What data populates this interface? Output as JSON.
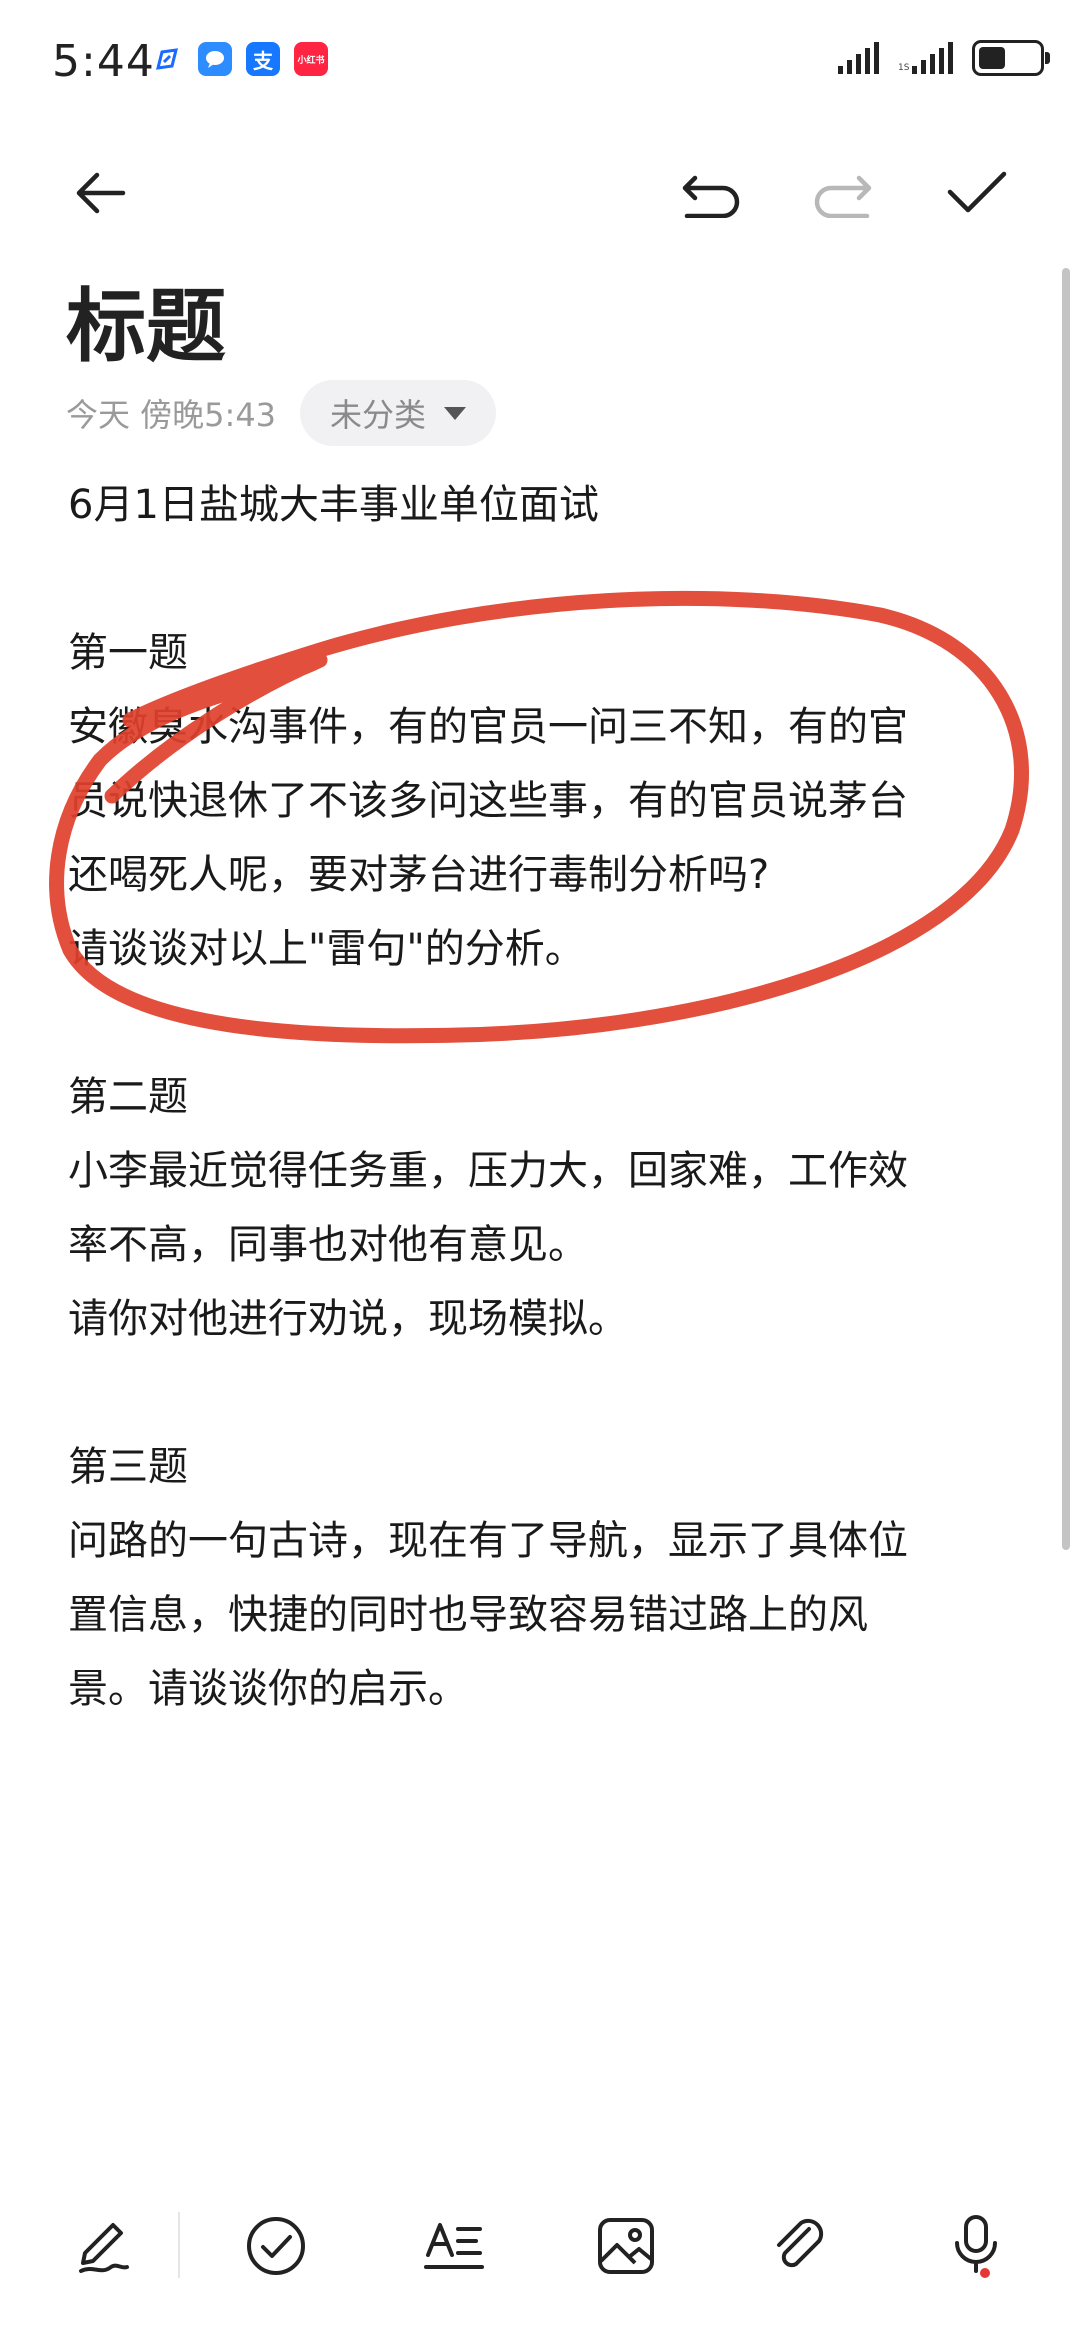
{
  "status_bar": {
    "time": "5:44",
    "notification_icons": [
      "edit-app-icon",
      "message-app-icon",
      "alipay-icon",
      "xiaohongshu-icon"
    ],
    "alipay_glyph": "支",
    "xiaohongshu_glyph": "小红书",
    "battery_level": 0.45
  },
  "toolbar": {
    "icons": [
      "back-arrow-icon",
      "undo-icon",
      "redo-icon",
      "checkmark-icon"
    ],
    "redo_disabled": true
  },
  "note": {
    "title": "标题",
    "date": "今天 傍晚5:43",
    "category": "未分类",
    "body_lines": [
      "6月1日盐城大丰事业单位面试",
      "",
      "第一题",
      "安徽臭水沟事件，有的官员一问三不知，有的官",
      "员说快退休了不该多问这些事，有的官员说茅台",
      "还喝死人呢，要对茅台进行毒制分析吗?",
      "请谈谈对以上\"雷句\"的分析。",
      "",
      "第二题",
      "小李最近觉得任务重，压力大，回家难，工作效",
      "率不高，同事也对他有意见。",
      "请你对他进行劝说，现场模拟。",
      "",
      "第三题",
      "问路的一句古诗，现在有了导航，显示了具体位",
      "置信息，快捷的同时也导致容易错过路上的风",
      "景。请谈谈你的启示。"
    ]
  },
  "bottom_toolbar": {
    "icons": [
      "pen-icon",
      "checklist-icon",
      "text-format-icon",
      "image-icon",
      "attachment-icon",
      "microphone-icon"
    ]
  },
  "colors": {
    "annotation": "#e0402b",
    "text": "#1a1a1a",
    "muted": "#9a9a9a",
    "chip_bg": "#f1f1f3",
    "disabled": "#b8b8b8",
    "mic_dot": "#e53935"
  }
}
